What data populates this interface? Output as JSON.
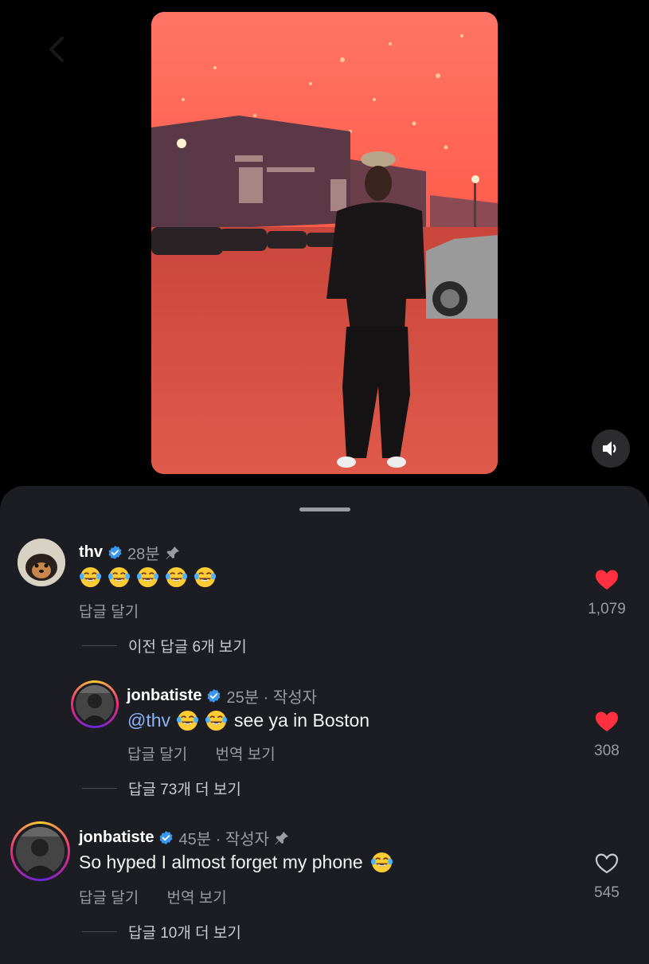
{
  "video": {
    "sound_icon": "speaker-icon"
  },
  "comments": [
    {
      "username": "thv",
      "time": "28분",
      "body_text": "",
      "emoji_count": 5,
      "reply_label": "답글 달기",
      "like_count": "1,079",
      "liked": true,
      "pinned": true,
      "view_replies": "이전 답글 6개 보기"
    },
    {
      "username": "jonbatiste",
      "time": "25분 · 작성자",
      "mention": "@thv",
      "body_text": "see ya in Boston",
      "emoji_count": 2,
      "reply_label": "답글 달기",
      "translate_label": "번역 보기",
      "like_count": "308",
      "liked": true,
      "view_replies": "답글 73개 더 보기"
    },
    {
      "username": "jonbatiste",
      "time": "45분 · 작성자",
      "body_text": "So hyped I almost forget my phone",
      "emoji_count": 1,
      "reply_label": "답글 달기",
      "translate_label": "번역 보기",
      "like_count": "545",
      "liked": false,
      "pinned": true,
      "view_replies": "답글 10개 더 보기"
    }
  ],
  "colors": {
    "sheet_bg": "#1b1d22",
    "like_red": "#ff3040",
    "verified_blue": "#3897f0",
    "mention_blue": "#8ab4f8"
  }
}
